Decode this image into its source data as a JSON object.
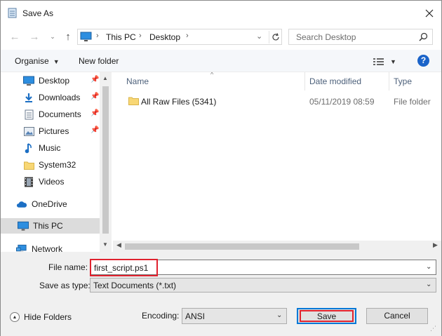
{
  "window": {
    "title": "Save As"
  },
  "address": {
    "crumbs": [
      "This PC",
      "Desktop"
    ],
    "sep": "›"
  },
  "search": {
    "placeholder": "Search Desktop"
  },
  "toolbar": {
    "organise": "Organise",
    "new_folder": "New folder",
    "help": "?"
  },
  "nav": {
    "items": [
      {
        "label": "Desktop",
        "icon": "desktop-icon",
        "pinned": true
      },
      {
        "label": "Downloads",
        "icon": "download-icon",
        "pinned": true
      },
      {
        "label": "Documents",
        "icon": "document-icon",
        "pinned": true
      },
      {
        "label": "Pictures",
        "icon": "pictures-icon",
        "pinned": true
      },
      {
        "label": "Music",
        "icon": "music-icon",
        "pinned": false
      },
      {
        "label": "System32",
        "icon": "folder-icon",
        "pinned": false
      },
      {
        "label": "Videos",
        "icon": "video-icon",
        "pinned": false
      },
      {
        "label": "OneDrive",
        "icon": "cloud-icon",
        "pinned": false
      },
      {
        "label": "This PC",
        "icon": "computer-icon",
        "pinned": false,
        "selected": true
      },
      {
        "label": "Network",
        "icon": "network-icon",
        "pinned": false
      }
    ]
  },
  "files": {
    "columns": [
      "Name",
      "Date modified",
      "Type"
    ],
    "rows": [
      {
        "name": "All Raw Files (5341)",
        "date": "05/11/2019 08:59",
        "type": "File folder"
      }
    ]
  },
  "form": {
    "file_name_label": "File name:",
    "file_name_value": "first_script.ps1",
    "save_type_label": "Save as type:",
    "save_type_value": "Text Documents (*.txt)",
    "hide_folders": "Hide Folders",
    "encoding_label": "Encoding:",
    "encoding_value": "ANSI",
    "save": "Save",
    "cancel": "Cancel"
  },
  "colors": {
    "accent": "#0078d7",
    "highlight": "#e0222e",
    "help": "#1a63c9",
    "folder": "#f8d775"
  }
}
